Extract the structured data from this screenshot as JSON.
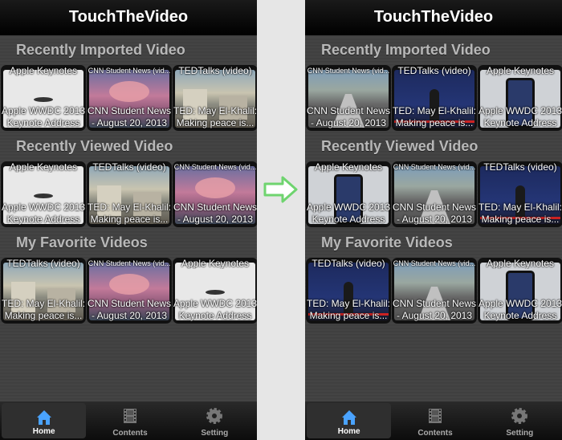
{
  "app_title": "TouchTheVideo",
  "sections": [
    "Recently Imported Video",
    "Recently Viewed Video",
    "My Favorite Videos"
  ],
  "tabs": [
    "Home",
    "Contents",
    "Setting"
  ],
  "left": {
    "rows": [
      [
        {
          "category": "Apple Keynotes",
          "title1": "Apple WWDC 2013",
          "title2": "Keynote Address",
          "thumb": "keynote"
        },
        {
          "category": "CNN Student News (vid...",
          "title1": "CNN Student News",
          "title2": "- August 20, 2013",
          "thumb": "fire"
        },
        {
          "category": "TEDTalks (video)",
          "title1": "TED: May El-Khalil:",
          "title2": "Making peace is...",
          "thumb": "city"
        }
      ],
      [
        {
          "category": "Apple Keynotes",
          "title1": "Apple WWDC 2013",
          "title2": "Keynote Address",
          "thumb": "keynote"
        },
        {
          "category": "TEDTalks (video)",
          "title1": "TED: May El-Khalil:",
          "title2": "Making peace is...",
          "thumb": "city"
        },
        {
          "category": "CNN Student News (vid...",
          "title1": "CNN Student News",
          "title2": "- August 20, 2013",
          "thumb": "fire"
        }
      ],
      [
        {
          "category": "TEDTalks (video)",
          "title1": "TED: May El-Khalil:",
          "title2": "Making peace is...",
          "thumb": "city"
        },
        {
          "category": "CNN Student News (vid...",
          "title1": "CNN Student News",
          "title2": "- August 20, 2013",
          "thumb": "fire"
        },
        {
          "category": "Apple Keynotes",
          "title1": "Apple WWDC 2013",
          "title2": "Keynote Address",
          "thumb": "keynote"
        }
      ]
    ]
  },
  "right": {
    "rows": [
      [
        {
          "category": "CNN Student News (vid...",
          "title1": "CNN Student News",
          "title2": "- August 20, 2013",
          "thumb": "highway"
        },
        {
          "category": "TEDTalks (video)",
          "title1": "TED: May El-Khalil:",
          "title2": "Making peace is...",
          "thumb": "stage"
        },
        {
          "category": "Apple Keynotes",
          "title1": "Apple WWDC 2013",
          "title2": "Keynote Address",
          "thumb": "phone"
        }
      ],
      [
        {
          "category": "Apple Keynotes",
          "title1": "Apple WWDC 2013",
          "title2": "Keynote Address",
          "thumb": "phone"
        },
        {
          "category": "CNN Student News (vid...",
          "title1": "CNN Student News",
          "title2": "- August 20, 2013",
          "thumb": "highway"
        },
        {
          "category": "TEDTalks (video)",
          "title1": "TED: May El-Khalil:",
          "title2": "Making peace is...",
          "thumb": "stage"
        }
      ],
      [
        {
          "category": "TEDTalks (video)",
          "title1": "TED: May El-Khalil:",
          "title2": "Making peace is...",
          "thumb": "stage"
        },
        {
          "category": "CNN Student News (vid...",
          "title1": "CNN Student News",
          "title2": "- August 20, 2013",
          "thumb": "highway"
        },
        {
          "category": "Apple Keynotes",
          "title1": "Apple WWDC 2013",
          "title2": "Keynote Address",
          "thumb": "phone"
        }
      ]
    ]
  },
  "colors": {
    "arrow_fill": "#ffffff",
    "arrow_stroke": "#6fd46f",
    "active_tab_icon": "#4aa3ff"
  }
}
